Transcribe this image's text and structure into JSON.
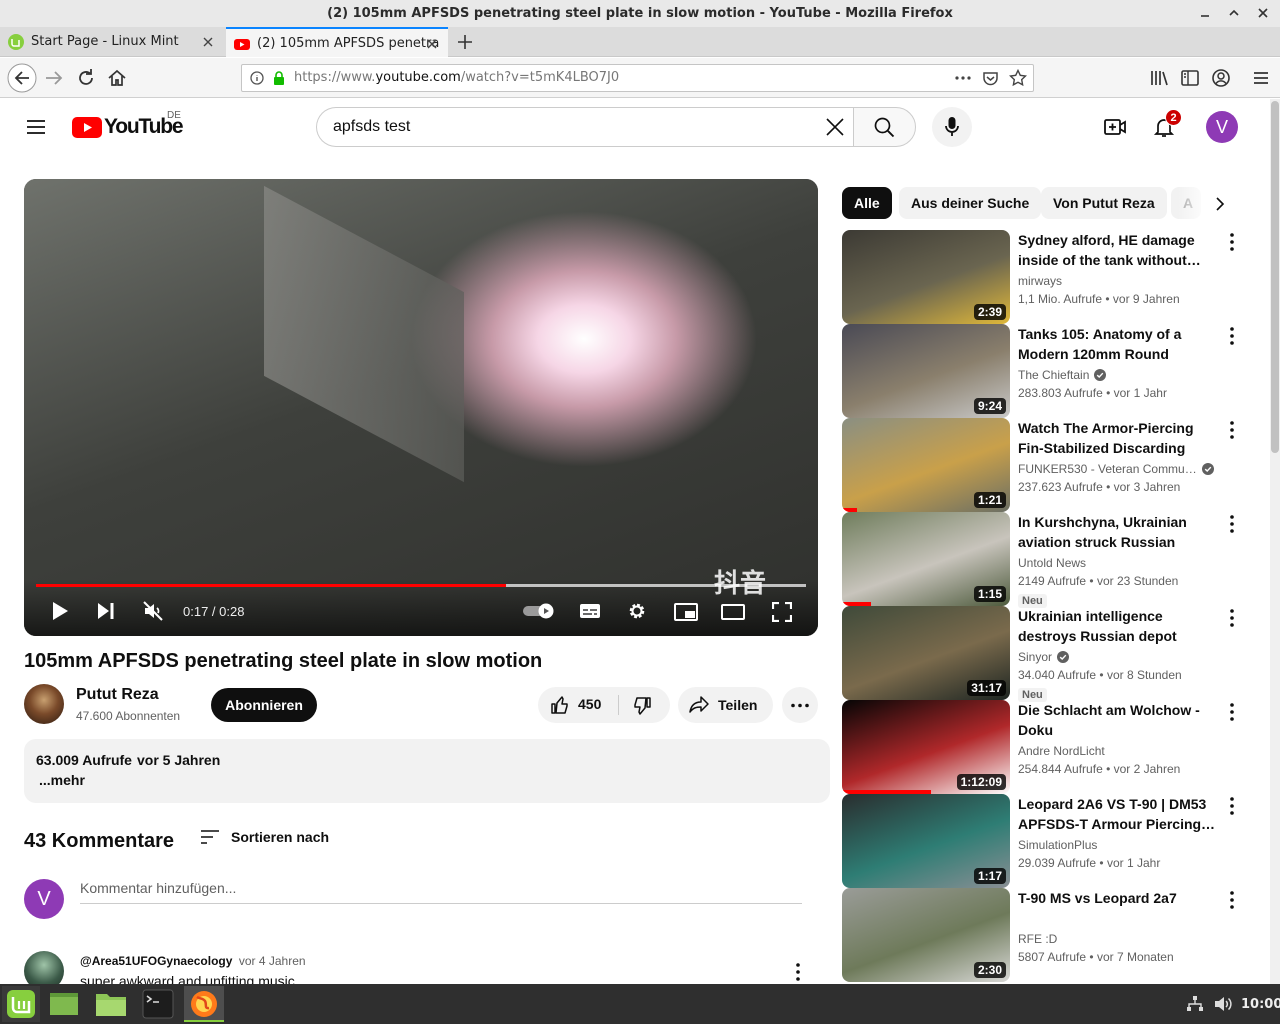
{
  "window": {
    "title": "(2) 105mm APFSDS penetrating steel plate in slow motion - YouTube - Mozilla Firefox"
  },
  "tabs": [
    {
      "label": "Start Page - Linux Mint"
    },
    {
      "label": "(2) 105mm APFSDS penetra"
    }
  ],
  "address": {
    "prefix": "https://www.",
    "host": "youtube.com",
    "path": "/watch?v=t5mK4LBO7J0"
  },
  "youtube": {
    "region": "DE",
    "logo_text": "YouTube",
    "search_value": "apfsds test",
    "notification_count": "2",
    "user_initial": "V"
  },
  "player": {
    "time": "0:17 / 0:28",
    "progress": 0.61,
    "buffered": 1.0,
    "watermark": "抖音"
  },
  "video": {
    "title": "105mm APFSDS penetrating steel plate in slow motion",
    "channel": "Putut Reza",
    "subscribers": "47.600 Abonnenten",
    "subscribe_label": "Abonnieren",
    "likes": "450",
    "share_label": "Teilen",
    "views": "63.009 Aufrufe",
    "age": "vor 5 Jahren",
    "more_label": "...mehr"
  },
  "comments": {
    "count_label": "43 Kommentare",
    "sort_label": "Sortieren nach",
    "placeholder": "Kommentar hinzufügen...",
    "first": {
      "author": "@Area51UFOGynaecology",
      "age": "vor 4 Jahren",
      "text": "super awkward and unfitting music"
    }
  },
  "chips": [
    "Alle",
    "Aus deiner Suche",
    "Von Putut Reza",
    "A"
  ],
  "recommendations": [
    {
      "title": "Sydney alford, HE damage inside of the tank without…",
      "channel": "mirways",
      "views": "1,1 Mio. Aufrufe",
      "age": "vor 9 Jahren",
      "duration": "2:39",
      "verified": false,
      "new": "",
      "watched": 0,
      "colors": [
        "#3c3a34",
        "#6a6550",
        "#e0b83a"
      ]
    },
    {
      "title": "Tanks 105: Anatomy of a Modern 120mm Round",
      "channel": "The Chieftain",
      "views": "283.803 Aufrufe",
      "age": "vor 1 Jahr",
      "duration": "9:24",
      "verified": true,
      "new": "",
      "watched": 0,
      "colors": [
        "#4a4a55",
        "#8a7f6c",
        "#c9c9c9"
      ]
    },
    {
      "title": "Watch The Armor-Piercing Fin-Stabilized Discarding Sabot…",
      "channel": "FUNKER530 - Veteran Commu…",
      "views": "237.623 Aufrufe",
      "age": "vor 3 Jahren",
      "duration": "1:21",
      "verified": true,
      "new": "",
      "watched": 0.09,
      "colors": [
        "#8a8f82",
        "#c9a04a",
        "#6b6f64"
      ]
    },
    {
      "title": "In Kurshchyna, Ukrainian aviation struck Russian troops…",
      "channel": "Untold News",
      "views": "2149 Aufrufe",
      "age": "vor 23 Stunden",
      "duration": "1:15",
      "verified": false,
      "new": "Neu",
      "watched": 0.17,
      "colors": [
        "#6f7d5c",
        "#c8c4bc",
        "#4d5a3c"
      ]
    },
    {
      "title": "Ukrainian intelligence destroys Russian depot containing ove…",
      "channel": "Sinyor",
      "views": "34.040 Aufrufe",
      "age": "vor 8 Stunden",
      "duration": "31:17",
      "verified": true,
      "new": "Neu",
      "watched": 0,
      "colors": [
        "#3f4a3a",
        "#7a6a4c",
        "#1d2522"
      ]
    },
    {
      "title": "Die Schlacht am Wolchow - Doku",
      "channel": "Andre NordLicht",
      "views": "254.844 Aufrufe",
      "age": "vor 2 Jahren",
      "duration": "1:12:09",
      "verified": false,
      "new": "",
      "watched": 0.53,
      "colors": [
        "#050505",
        "#b0282a",
        "#ffffff"
      ]
    },
    {
      "title": "Leopard 2A6 VS T-90 | DM53 APFSDS-T Armour Piercing…",
      "channel": "SimulationPlus",
      "views": "29.039 Aufrufe",
      "age": "vor 1 Jahr",
      "duration": "1:17",
      "verified": false,
      "new": "",
      "watched": 0,
      "colors": [
        "#2a2d2e",
        "#2e7d74",
        "#8a8f94"
      ]
    },
    {
      "title": "T-90 MS vs Leopard 2a7",
      "channel": "RFE :D",
      "views": "5807 Aufrufe",
      "age": "vor 7 Monaten",
      "duration": "2:30",
      "verified": false,
      "new": "",
      "watched": 0,
      "colors": [
        "#9a9c98",
        "#6e7a5a",
        "#d8d8d6"
      ]
    }
  ],
  "taskbar": {
    "clock": "10:00"
  }
}
